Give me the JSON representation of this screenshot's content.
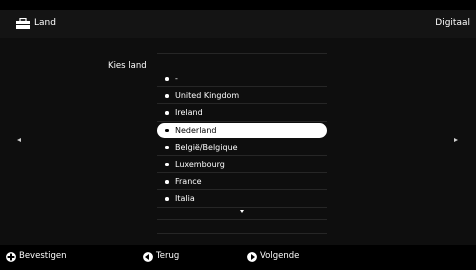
{
  "header": {
    "title": "Land",
    "source": "Digitaal",
    "icon": "briefcase-icon"
  },
  "main": {
    "label": "Kies land",
    "countries": [
      "-",
      "United Kingdom",
      "Ireland",
      "Nederland",
      "België/Belgique",
      "Luxembourg",
      "France",
      "Italia"
    ],
    "selected": "Nederland"
  },
  "footer": {
    "confirm": "Bevestigen",
    "back": "Terug",
    "next": "Volgende"
  },
  "colors": {
    "background": "#000000",
    "header_bg": "#141414",
    "highlight": "#ffffff"
  }
}
